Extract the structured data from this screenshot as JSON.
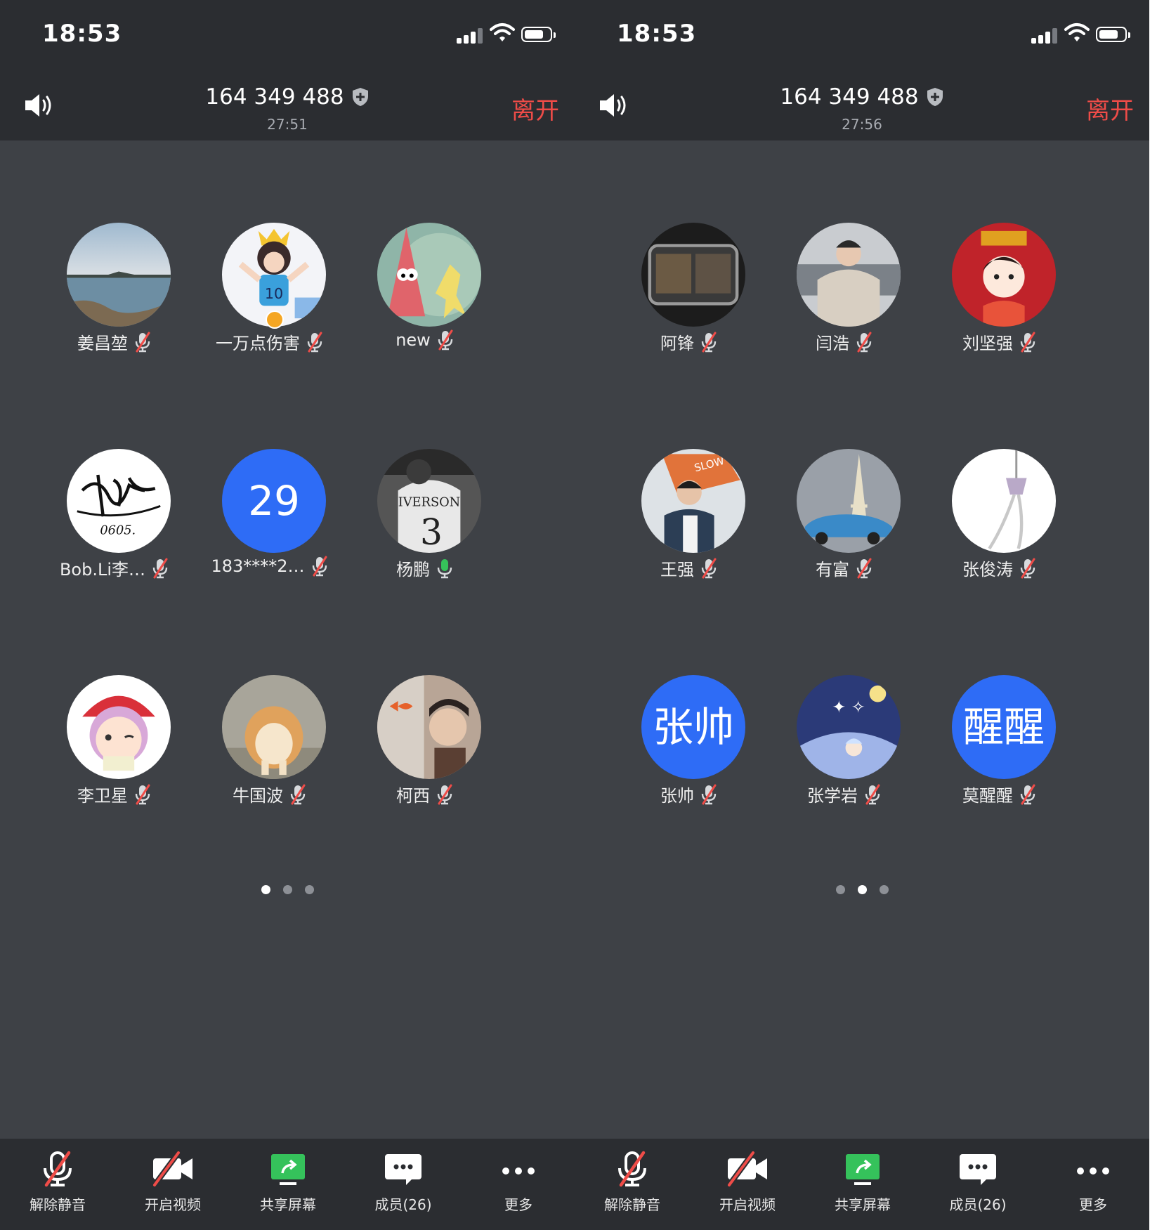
{
  "colors": {
    "background": "#3e4146",
    "bar": "#2b2d31",
    "leave": "#ef4c48",
    "avatar_blue": "#2e6cf6",
    "mic_on": "#36c25a",
    "mute_slash": "#ef4c48"
  },
  "screens": [
    {
      "status": {
        "time": "18:53"
      },
      "header": {
        "meeting_id": "164 349 488",
        "elapsed": "27:51",
        "leave_label": "离开"
      },
      "participants": [
        {
          "name": "姜昌堃",
          "mic": "muted",
          "avatar": "photo-lake"
        },
        {
          "name": "一万点伤害",
          "mic": "muted",
          "avatar": "photo-cartoon-king",
          "host_badge": true
        },
        {
          "name": "new",
          "mic": "muted",
          "avatar": "photo-patrick"
        },
        {
          "name": "Bob.Li李…",
          "mic": "muted",
          "avatar": "photo-signature"
        },
        {
          "name": "183****2…",
          "mic": "muted",
          "avatar": "text",
          "avatar_text": "29"
        },
        {
          "name": "杨鹏",
          "mic": "active",
          "avatar": "photo-iverson"
        },
        {
          "name": "李卫星",
          "mic": "muted",
          "avatar": "photo-anime-boy"
        },
        {
          "name": "牛国波",
          "mic": "muted",
          "avatar": "photo-corgi"
        },
        {
          "name": "柯西",
          "mic": "muted",
          "avatar": "photo-goldfish"
        }
      ],
      "page_indicator": {
        "count": 3,
        "active": 0
      },
      "toolbar": [
        {
          "label": "解除静音",
          "icon": "mic-muted-icon"
        },
        {
          "label": "开启视频",
          "icon": "video-off-icon"
        },
        {
          "label": "共享屏幕",
          "icon": "share-screen-icon"
        },
        {
          "label": "成员(26)",
          "icon": "members-chat-icon"
        },
        {
          "label": "更多",
          "icon": "more-icon"
        }
      ]
    },
    {
      "status": {
        "time": "18:53"
      },
      "header": {
        "meeting_id": "164 349 488",
        "elapsed": "27:56",
        "leave_label": "离开"
      },
      "participants": [
        {
          "name": "阿锋",
          "mic": "muted",
          "avatar": "photo-subway"
        },
        {
          "name": "闫浩",
          "mic": "muted",
          "avatar": "photo-hoodie"
        },
        {
          "name": "刘坚强",
          "mic": "muted",
          "avatar": "photo-red-cartoon"
        },
        {
          "name": "王强",
          "mic": "muted",
          "avatar": "photo-slow-down"
        },
        {
          "name": "有富",
          "mic": "muted",
          "avatar": "photo-eiffel-car"
        },
        {
          "name": "张俊涛",
          "mic": "muted",
          "avatar": "photo-white-ornament"
        },
        {
          "name": "张帅",
          "mic": "muted",
          "avatar": "text",
          "avatar_text": "张帅"
        },
        {
          "name": "张学岩",
          "mic": "muted",
          "avatar": "photo-night-anime"
        },
        {
          "name": "莫醒醒",
          "mic": "muted",
          "avatar": "text",
          "avatar_text": "醒醒"
        }
      ],
      "page_indicator": {
        "count": 3,
        "active": 1
      },
      "toolbar": [
        {
          "label": "解除静音",
          "icon": "mic-muted-icon"
        },
        {
          "label": "开启视频",
          "icon": "video-off-icon"
        },
        {
          "label": "共享屏幕",
          "icon": "share-screen-icon"
        },
        {
          "label": "成员(26)",
          "icon": "members-chat-icon"
        },
        {
          "label": "更多",
          "icon": "more-icon"
        }
      ]
    }
  ]
}
